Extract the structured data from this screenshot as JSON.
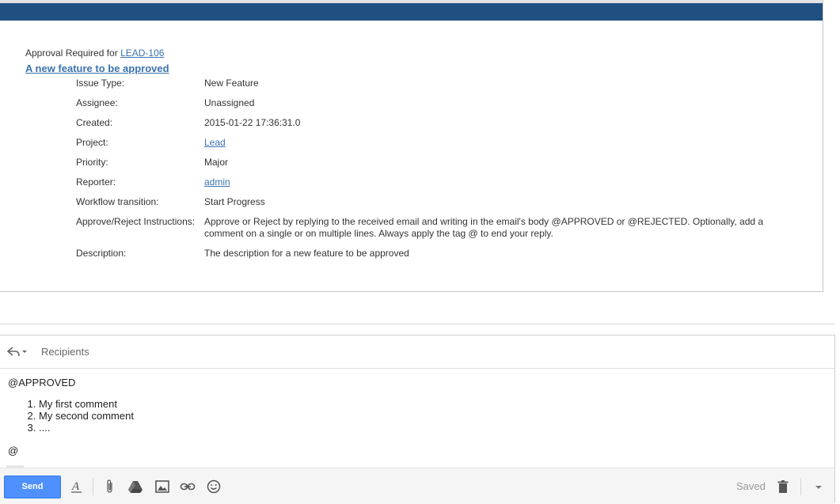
{
  "email": {
    "approval_prefix": "Approval Required for ",
    "issue_key": "LEAD-106",
    "issue_title": "A new feature to be approved",
    "fields": [
      {
        "label": "Issue Type:",
        "value": "New Feature",
        "is_link": false
      },
      {
        "label": "Assignee:",
        "value": "Unassigned",
        "is_link": false
      },
      {
        "label": "Created:",
        "value": "2015-01-22 17:36:31.0",
        "is_link": false
      },
      {
        "label": "Project:",
        "value": "Lead",
        "is_link": true
      },
      {
        "label": "Priority:",
        "value": "Major",
        "is_link": false
      },
      {
        "label": "Reporter:",
        "value": "admin",
        "is_link": true
      },
      {
        "label": "Workflow transition:",
        "value": "Start Progress",
        "is_link": false
      },
      {
        "label": "Approve/Reject Instructions:",
        "value": "Approve or Reject by replying to the received email and writing in the email's body @APPROVED or @REJECTED. Optionally, add a comment on a single or on multiple lines. Always apply the tag @ to end your reply.",
        "is_link": false
      },
      {
        "label": "Description:",
        "value": "The description for a new feature to be approved",
        "is_link": false
      }
    ]
  },
  "compose": {
    "recipients_label": "Recipients",
    "body_tag": "@APPROVED",
    "comments": [
      "My first comment",
      "My second comment",
      "...."
    ],
    "end_tag": "@"
  },
  "toolbar": {
    "send_label": "Send",
    "saved_label": "Saved"
  },
  "colors": {
    "header_bar": "#205081",
    "link": "#3b73af",
    "send_button": "#4d90fe"
  },
  "icons": [
    "reply-icon",
    "chevron-down-icon",
    "formatting-icon",
    "attachment-icon",
    "drive-icon",
    "image-icon",
    "link-icon",
    "emoji-icon",
    "trash-icon",
    "more-options-icon"
  ]
}
